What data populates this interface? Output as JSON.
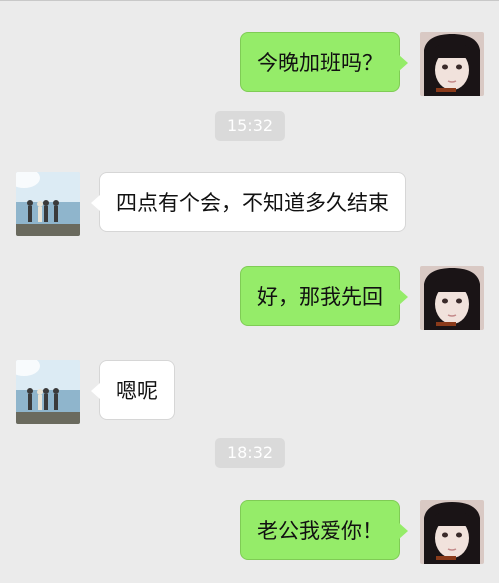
{
  "messages": [
    {
      "side": "me",
      "text": "今晚加班吗？"
    },
    {
      "time": "15:32"
    },
    {
      "side": "other",
      "text": "四点有个会，不知道多久结束"
    },
    {
      "side": "me",
      "text": "好，那我先回"
    },
    {
      "side": "other",
      "text": "嗯呢"
    },
    {
      "time": "18:32"
    },
    {
      "side": "me",
      "text": "老公我爱你！"
    }
  ],
  "colors": {
    "background": "#ebebeb",
    "sent_bubble": "#95ec69",
    "received_bubble": "#ffffff",
    "timestamp_bg": "#dadada"
  },
  "icons": {
    "me_avatar": "girl-portrait-avatar-icon",
    "other_avatar": "four-people-beach-avatar-icon"
  }
}
